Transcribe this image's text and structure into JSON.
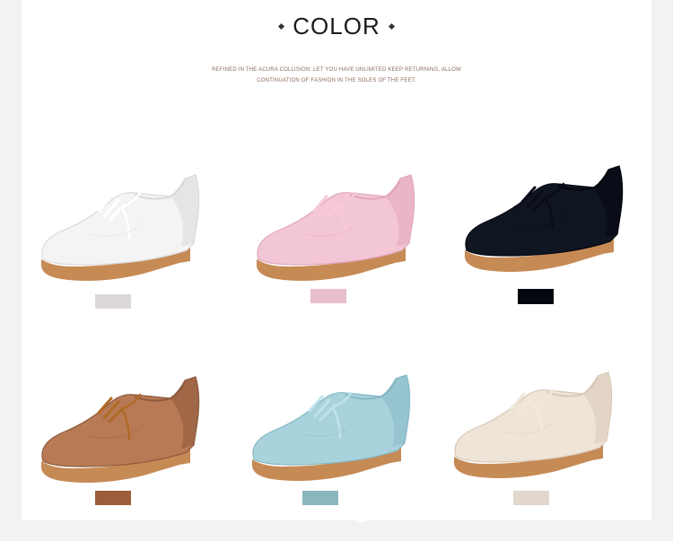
{
  "header": {
    "title": "COLOR",
    "subtitle_line1": "REFINED IN THE ACURA COLLISION: LET YOU HAVE UNLIMITED KEEP RETURNING, ALLOW",
    "subtitle_line2": "CONTINUATION OF FASHION IN THE SOLES OF THE FEET."
  },
  "colors": [
    {
      "name": "white",
      "upper": "#f4f4f4",
      "shade": "#d9d9d9",
      "lace": "#ffffff",
      "swatch": "#ddd8d8"
    },
    {
      "name": "pink",
      "upper": "#f3c6d6",
      "shade": "#e2a7bb",
      "lace": "#f7c9d8",
      "swatch": "#e9bfcb"
    },
    {
      "name": "black",
      "upper": "#101522",
      "shade": "#05080f",
      "lace": "#0a0d16",
      "swatch": "#05070f"
    },
    {
      "name": "brown",
      "upper": "#b87a55",
      "shade": "#8d5a3c",
      "lace": "#b06a25",
      "swatch": "#9b5d3c"
    },
    {
      "name": "light-blue",
      "upper": "#a9d3dc",
      "shade": "#86b8c4",
      "lace": "#bfe3ec",
      "swatch": "#8ab7bd"
    },
    {
      "name": "beige",
      "upper": "#efe4d8",
      "shade": "#d8c9b8",
      "lace": "#f2e8dc",
      "swatch": "#e2d7cc"
    }
  ],
  "sole_color": "#c68a55"
}
